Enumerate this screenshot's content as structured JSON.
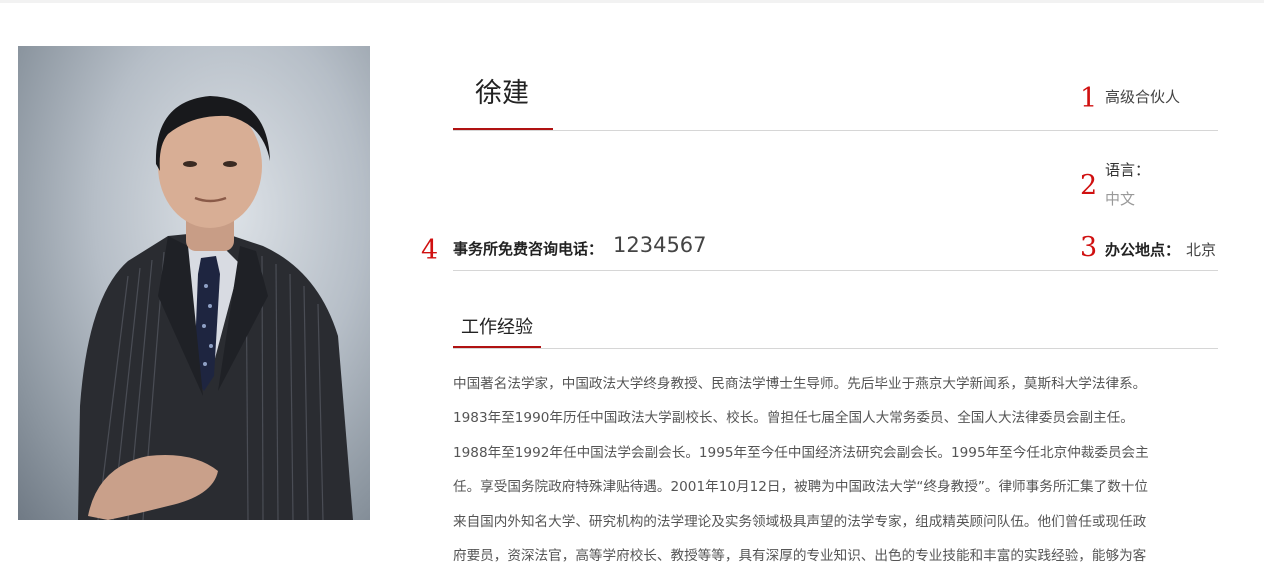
{
  "profile": {
    "name": "徐建",
    "title": "高级合伙人",
    "language_label": "语言：",
    "language_value": "中文",
    "phone_label": "事务所免费咨询电话：",
    "phone_value": "1234567",
    "office_label": "办公地点：",
    "office_value": "北京"
  },
  "markers": {
    "m1": "1",
    "m2": "2",
    "m3": "3",
    "m4": "4"
  },
  "section": {
    "title": "工作经验"
  },
  "bio": {
    "lines": [
      "中国著名法学家，中国政法大学终身教授、民商法学博士生导师。先后毕业于燕京大学新闻系，莫斯科大学法律系。",
      "1983年至1990年历任中国政法大学副校长、校长。曾担任七届全国人大常务委员、全国人大法律委员会副主任。",
      "1988年至1992年任中国法学会副会长。1995年至今任中国经济法研究会副会长。1995年至今任北京仲裁委员会主",
      "任。享受国务院政府特殊津贴待遇。2001年10月12日，被聘为中国政法大学“终身教授”。律师事务所汇集了数十位",
      "来自国内外知名大学、研究机构的法学理论及实务领域极具声望的法学专家，组成精英顾问队伍。他们曾任或现任政",
      "府要员，资深法官，高等学府校长、教授等等，具有深厚的专业知识、出色的专业技能和丰富的实践经验，能够为客"
    ]
  },
  "colors": {
    "accent": "#b01212",
    "marker": "#d01010",
    "rule": "#d6d6d6"
  }
}
